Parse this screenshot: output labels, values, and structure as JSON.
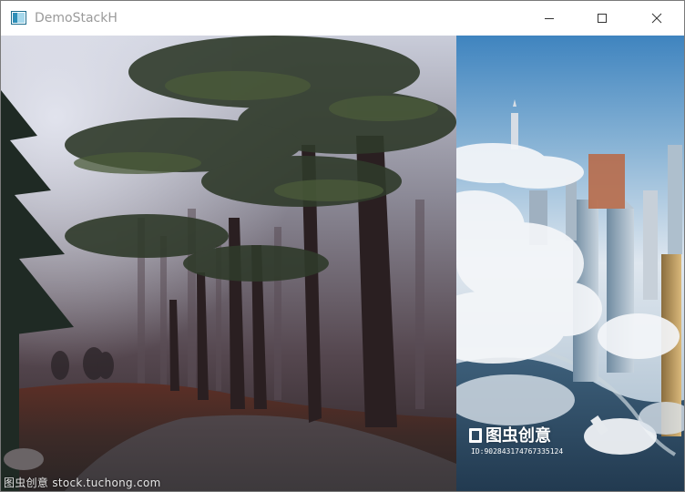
{
  "window": {
    "title": "DemoStackH",
    "controls": {
      "minimize": "minimize",
      "maximize": "maximize",
      "close": "close"
    }
  },
  "panes": {
    "left": {
      "description_icon": "forest-photo",
      "watermark": "图虫创意 stock.tuchong.com"
    },
    "right": {
      "description_icon": "city-in-clouds-photo",
      "watermark_logo": "图虫创意",
      "watermark_id": "ID:902843174767335124"
    }
  },
  "colors": {
    "titlebar_bg": "#ffffff",
    "title_text": "#9a9a9a",
    "border": "#7a7a7a"
  }
}
